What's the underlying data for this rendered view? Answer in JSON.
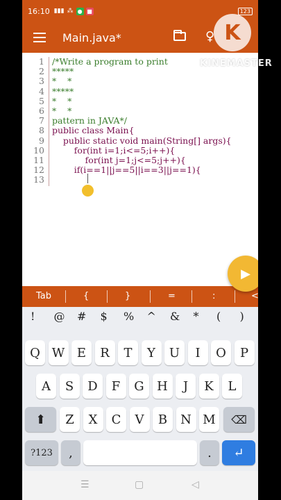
{
  "status": {
    "time": "16:10",
    "battery": "123"
  },
  "appbar": {
    "title": "Main.java*"
  },
  "watermark": {
    "text": "KINEMASTER",
    "logo_letter": "K"
  },
  "editor": {
    "lines": [
      {
        "n": "1",
        "code": "/*Write a program to print"
      },
      {
        "n": "2",
        "code": "*****"
      },
      {
        "n": "3",
        "code": "*    *"
      },
      {
        "n": "4",
        "code": "*****"
      },
      {
        "n": "5",
        "code": "*    *"
      },
      {
        "n": "6",
        "code": "*    *"
      },
      {
        "n": "7",
        "code": "pattern in JAVA*/"
      },
      {
        "n": "8",
        "code": "public class Main{"
      },
      {
        "n": "9",
        "code": "    public static void main(String[] args){"
      },
      {
        "n": "10",
        "code": "        for(int i=1;i<=5;i++){"
      },
      {
        "n": "11",
        "code": "            for(int j=1;j<=5;j++){"
      },
      {
        "n": "12",
        "code": "        if(i==1||j==5||i==3||j==1){"
      },
      {
        "n": "13",
        "code": ""
      }
    ]
  },
  "symbols": [
    "Tab",
    "{",
    "}",
    "=",
    ":",
    "<"
  ],
  "keyboard": {
    "symbol_row": [
      "!",
      "@",
      "#",
      "$",
      "%",
      "^",
      "&",
      "*",
      "(",
      ")"
    ],
    "row1": [
      "Q",
      "W",
      "E",
      "R",
      "T",
      "Y",
      "U",
      "I",
      "O",
      "P"
    ],
    "row2": [
      "A",
      "S",
      "D",
      "F",
      "G",
      "H",
      "J",
      "K",
      "L"
    ],
    "row3": [
      "Z",
      "X",
      "C",
      "V",
      "B",
      "N",
      "M"
    ],
    "numbers_key": "?123",
    "comma_key": ",",
    "period_key": "."
  },
  "colors": {
    "accent": "#cc5314",
    "comment": "#3a7d2c",
    "keyword": "#7a0f4e",
    "handle": "#f2bf2c"
  }
}
